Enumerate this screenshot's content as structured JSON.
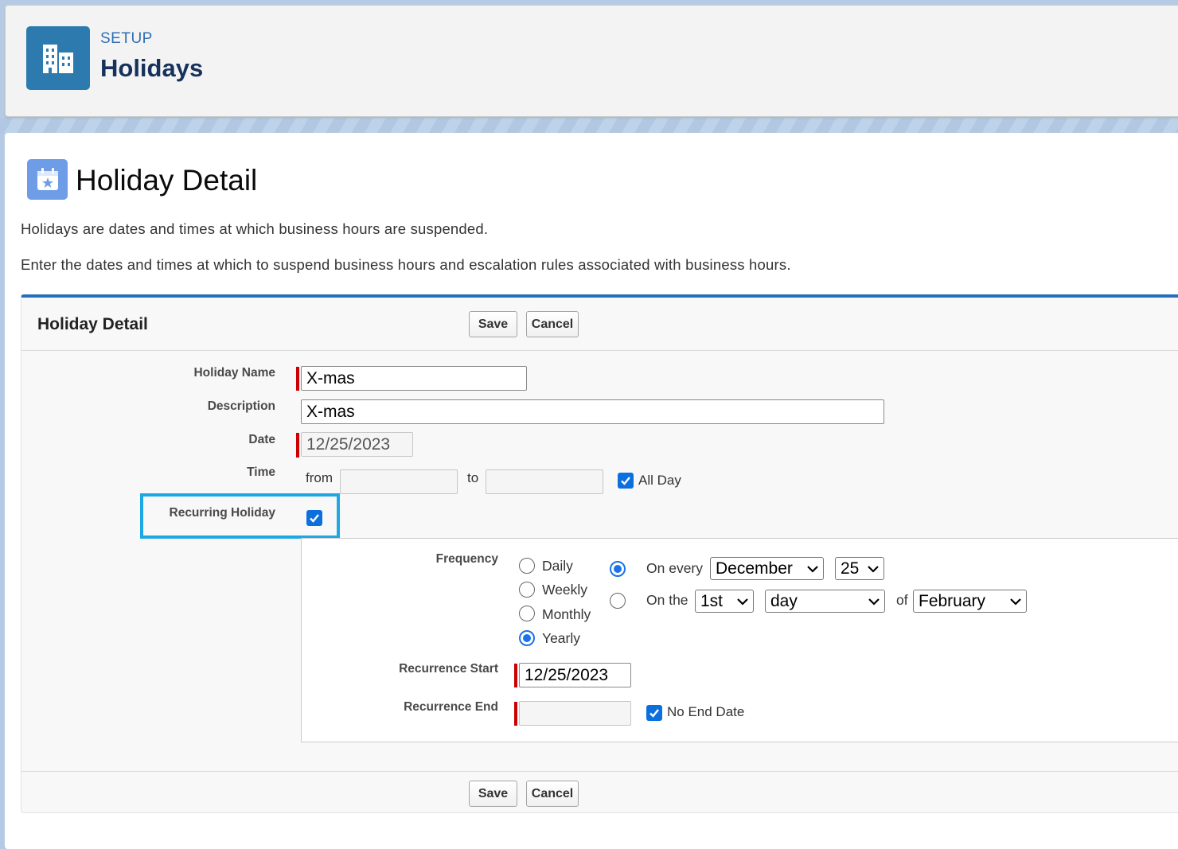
{
  "header": {
    "section_label": "SETUP",
    "title": "Holidays",
    "icon": "building-icon"
  },
  "page": {
    "title": "Holiday Detail",
    "icon": "calendar-star-icon",
    "description_1": "Holidays are dates and times at which business hours are suspended.",
    "description_2": "Enter the dates and times at which to suspend business hours and escalation rules associated with business hours."
  },
  "form": {
    "section_title": "Holiday Detail",
    "save_label": "Save",
    "cancel_label": "Cancel",
    "holiday_name_label": "Holiday Name",
    "holiday_name_value": "X-mas",
    "description_label": "Description",
    "description_value": "X-mas",
    "date_label": "Date",
    "date_value": "12/25/2023",
    "time_label": "Time",
    "time_from_label": "from",
    "time_from_value": "",
    "time_to_label": "to",
    "time_to_value": "",
    "all_day_label": "All Day",
    "all_day_checked": true,
    "recurring_label": "Recurring Holiday",
    "recurring_checked": true
  },
  "recurrence": {
    "frequency_label": "Frequency",
    "frequency_options": [
      "Daily",
      "Weekly",
      "Monthly",
      "Yearly"
    ],
    "frequency_selected": "Yearly",
    "on_every_label": "On every",
    "on_every_month": "December",
    "on_every_day": "25",
    "on_the_label": "On the",
    "on_the_ordinal": "1st",
    "on_the_day": "day",
    "of_label": "of",
    "of_month": "February",
    "start_label": "Recurrence Start",
    "start_value": "12/25/2023",
    "end_label": "Recurrence End",
    "end_value": "",
    "no_end_date_label": "No End Date",
    "no_end_date_checked": true
  },
  "colors": {
    "accent_blue": "#236fbd",
    "required_red": "#cc0000",
    "highlight": "#1ea8e3",
    "checkbox_blue": "#0b6fde"
  }
}
